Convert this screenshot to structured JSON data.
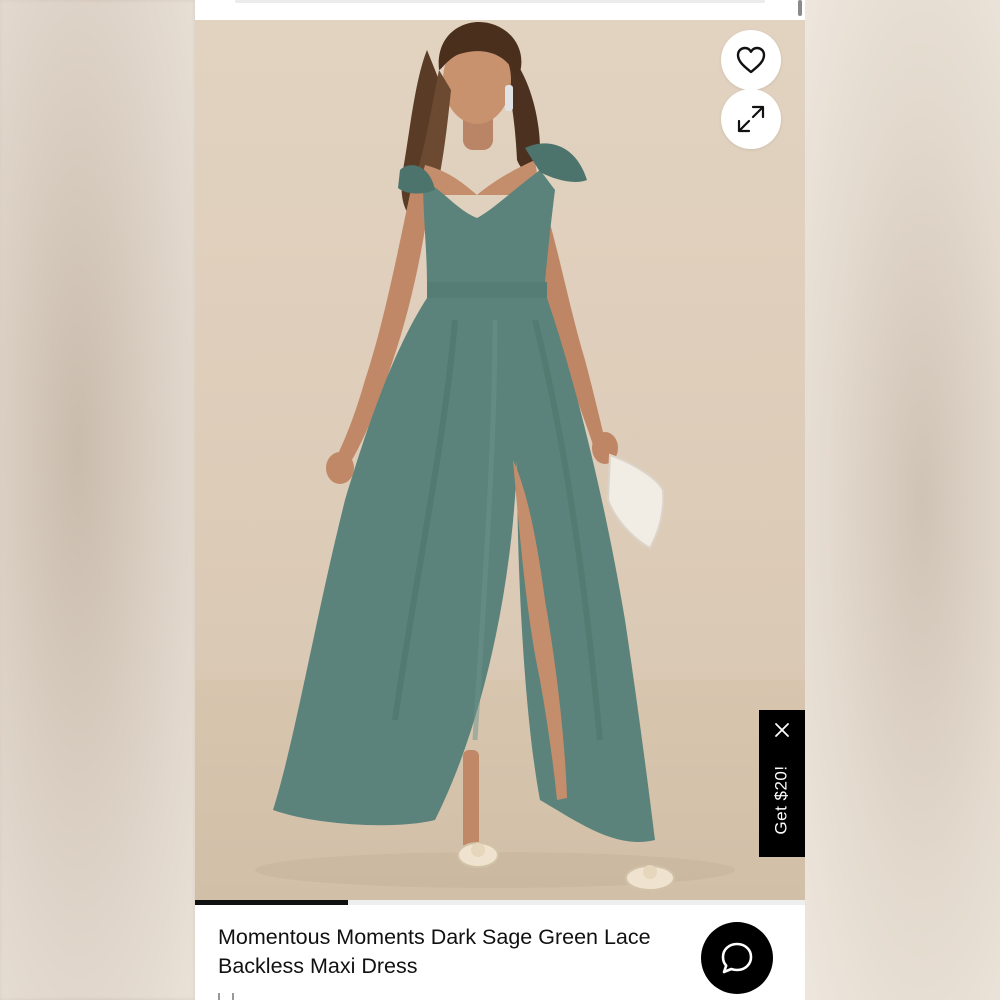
{
  "product": {
    "title_line1": "Momentous Moments Dark Sage Green Lace",
    "title_line2": "Backless Maxi Dress",
    "dress_color": "#5b837b"
  },
  "actions": {
    "favorite_icon": "heart-icon",
    "expand_icon": "expand-icon",
    "chat_icon": "chat-bubble-icon"
  },
  "promo": {
    "label": "Get $20!",
    "close_icon": "close-icon"
  },
  "gallery": {
    "progress": 0.25
  },
  "colors": {
    "background": "#ffffff",
    "promo_bg": "#000000",
    "text": "#111111",
    "photo_backdrop": "#e2d3c1"
  }
}
